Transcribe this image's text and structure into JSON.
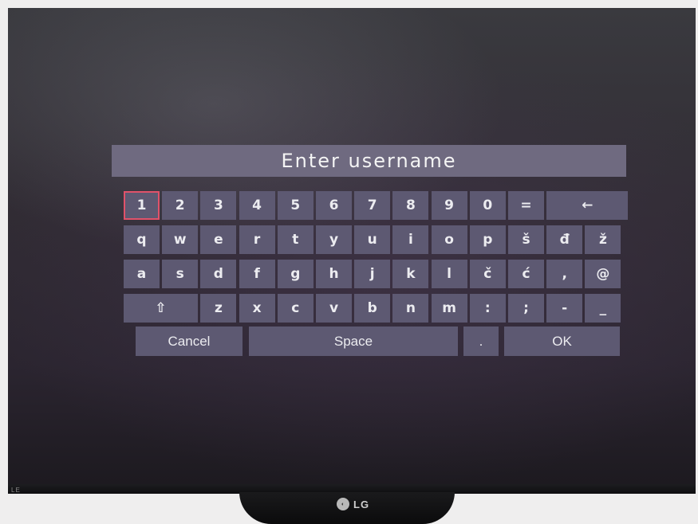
{
  "dialog": {
    "title": "Enter username"
  },
  "keyboard": {
    "row1": [
      "1",
      "2",
      "3",
      "4",
      "5",
      "6",
      "7",
      "8",
      "9",
      "0",
      "=",
      "←"
    ],
    "row2": [
      "q",
      "w",
      "e",
      "r",
      "t",
      "y",
      "u",
      "i",
      "o",
      "p",
      "š",
      "đ",
      "ž"
    ],
    "row3": [
      "a",
      "s",
      "d",
      "f",
      "g",
      "h",
      "j",
      "k",
      "l",
      "č",
      "ć",
      ",",
      "@"
    ],
    "row4": [
      "⇧",
      "z",
      "x",
      "c",
      "v",
      "b",
      "n",
      "m",
      ":",
      ";",
      "-",
      "_"
    ],
    "row5": [
      "Cancel",
      "Space",
      ".",
      "OK"
    ],
    "selected_key": "1"
  },
  "monitor": {
    "brand": "LG",
    "brand_left": "LE"
  },
  "colors": {
    "key_bg": "#5d5972",
    "title_bg": "#6f6a80",
    "selection_border": "#e0526a"
  }
}
